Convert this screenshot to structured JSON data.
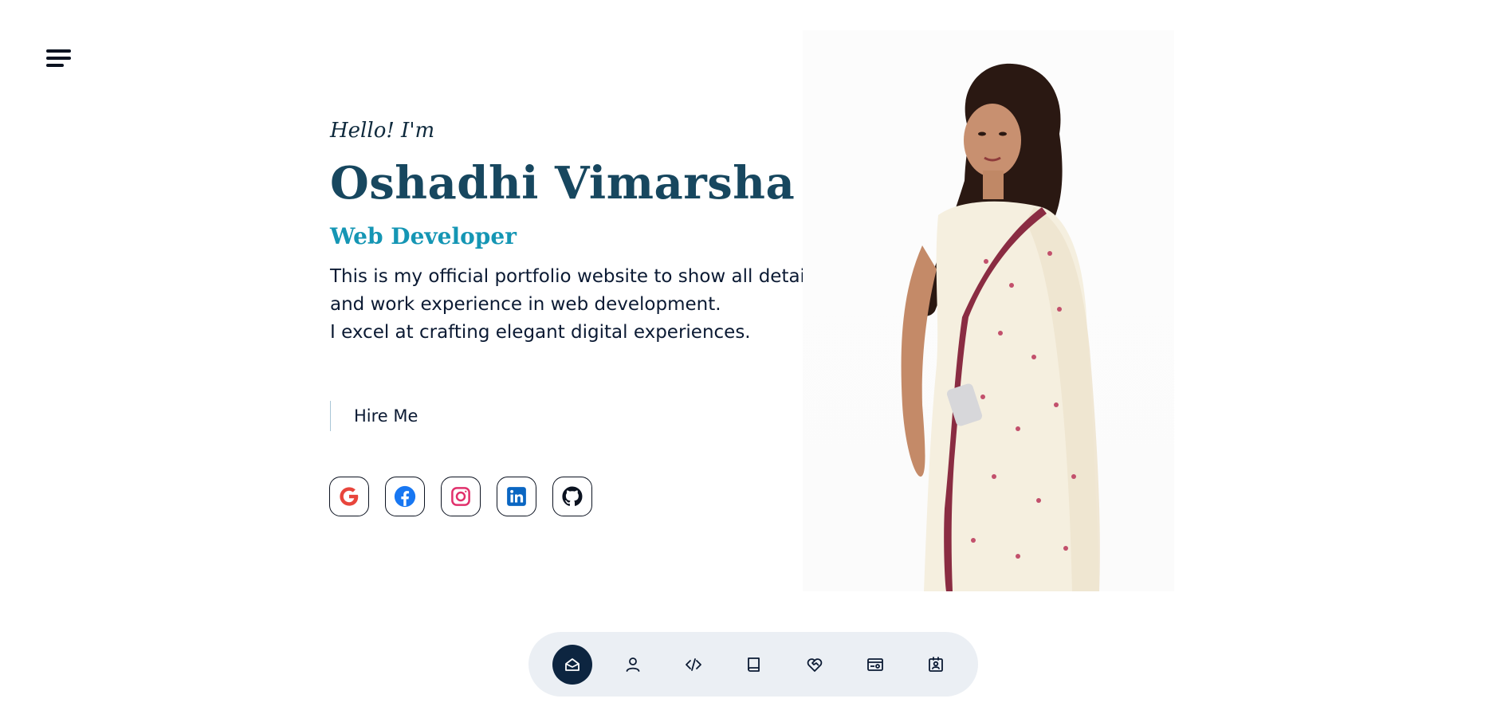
{
  "hero": {
    "greeting": "Hello! I'm",
    "name": "Oshadhi Vimarsha",
    "role": "Web Developer",
    "description_lines": [
      "This is my official portfolio website to show all details",
      "and work experience in web development.",
      "I excel at crafting elegant digital experiences."
    ],
    "cta_label": "Hire Me"
  },
  "socials": [
    {
      "icon": "google-icon",
      "color": "#ea4335"
    },
    {
      "icon": "facebook-icon",
      "color": "#1877f2"
    },
    {
      "icon": "instagram-icon",
      "color": "#e1306c"
    },
    {
      "icon": "linkedin-icon",
      "color": "#0a66c2"
    },
    {
      "icon": "github-icon",
      "color": "#0b1220"
    }
  ],
  "dock": {
    "active": "home",
    "items": [
      "home-icon",
      "user-icon",
      "code-icon",
      "book-icon",
      "heart-handshake-icon",
      "projects-icon",
      "contact-icon"
    ]
  },
  "colors": {
    "name": "#17475f",
    "role": "#1596b4",
    "text": "#0b1a33",
    "dock_bg": "#ebeff4",
    "dock_active": "#0d2540"
  }
}
